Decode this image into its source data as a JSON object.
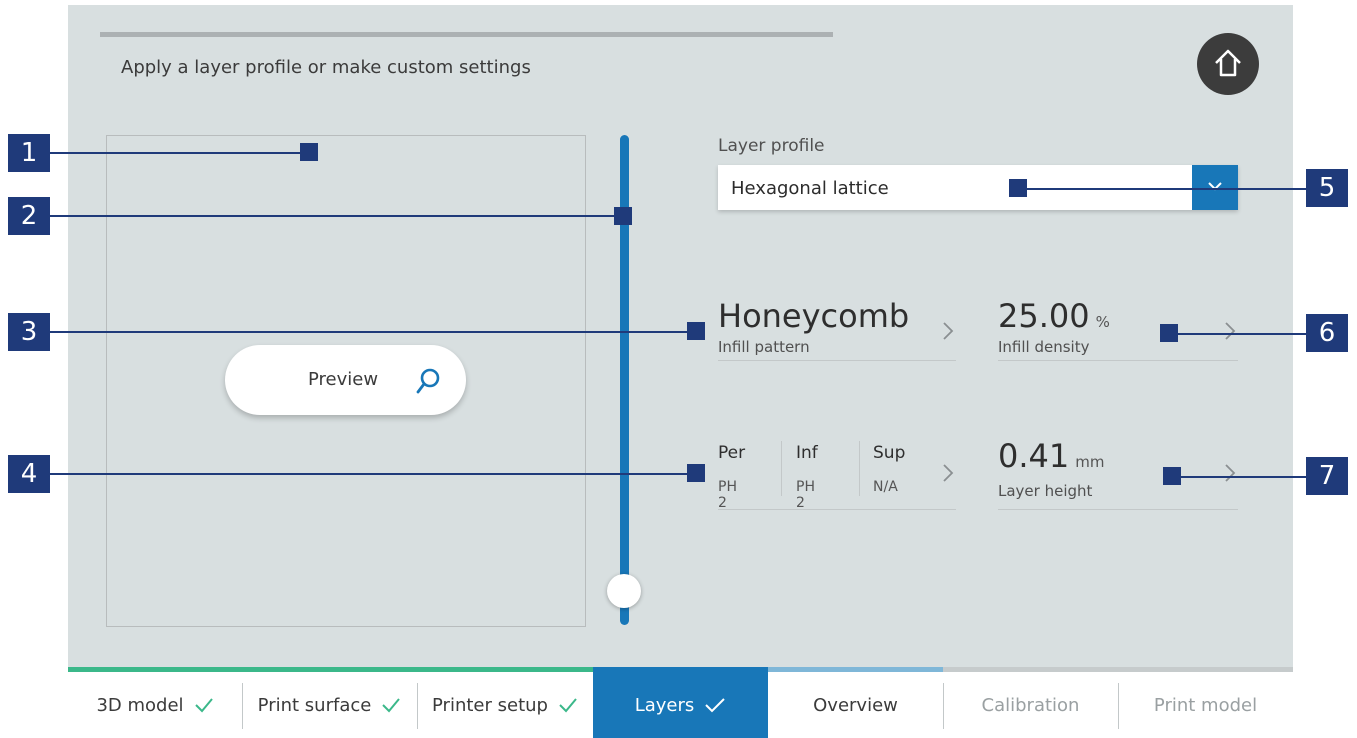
{
  "header": {
    "title": "Apply a layer profile or make custom settings",
    "home_icon": "home-icon"
  },
  "preview": {
    "button_label": "Preview",
    "icon": "search-icon"
  },
  "layer_slider": {
    "value_fraction": 0.0
  },
  "layer_profile": {
    "label": "Layer profile",
    "selected": "Hexagonal lattice",
    "icon": "chevron-down-icon"
  },
  "infill_pattern": {
    "value": "Honeycomb",
    "label": "Infill pattern"
  },
  "infill_density": {
    "value": "25.00",
    "unit": "%",
    "label": "Infill density"
  },
  "extruders": {
    "columns": [
      {
        "header": "Per",
        "value": "PH 2"
      },
      {
        "header": "Inf",
        "value": "PH 2"
      },
      {
        "header": "Sup",
        "value": "N/A"
      }
    ]
  },
  "layer_height": {
    "value": "0.41",
    "unit": "mm",
    "label": "Layer height"
  },
  "callouts": [
    "1",
    "2",
    "3",
    "4",
    "5",
    "6",
    "7"
  ],
  "nav": {
    "steps": [
      {
        "label": "3D model",
        "state": "done"
      },
      {
        "label": "Print surface",
        "state": "done"
      },
      {
        "label": "Printer setup",
        "state": "done"
      },
      {
        "label": "Layers",
        "state": "active"
      },
      {
        "label": "Overview",
        "state": "next"
      },
      {
        "label": "Calibration",
        "state": "disabled"
      },
      {
        "label": "Print model",
        "state": "disabled"
      }
    ]
  },
  "colors": {
    "accent": "#1877b8",
    "done_green": "#3bb88a",
    "callout": "#1f3a7a",
    "background": "#d8dfe0"
  }
}
